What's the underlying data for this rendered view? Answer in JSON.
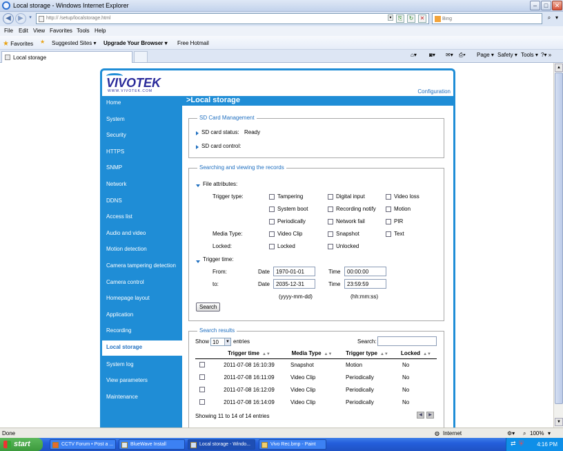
{
  "window": {
    "title": "Local storage - Windows Internet Explorer"
  },
  "address": {
    "url": "http://                    /setup/localstorage.html",
    "search_placeholder": "Bing"
  },
  "menu": [
    "File",
    "Edit",
    "View",
    "Favorites",
    "Tools",
    "Help"
  ],
  "favorites": {
    "label": "Favorites",
    "suggested": "Suggested Sites ▾",
    "upgrade": "Upgrade Your Browser ▾",
    "hotmail": "Free Hotmail"
  },
  "tab": {
    "label": "Local storage"
  },
  "ie_tools": {
    "page": "Page ▾",
    "safety": "Safety ▾",
    "tools": "Tools ▾"
  },
  "brand": {
    "logo": "VIVOTEK",
    "logo_sub": "WWW.VIVOTEK.COM",
    "config": "Configuration",
    "accent_color": "#1f8dd6"
  },
  "sidebar": {
    "items": [
      {
        "label": "Home"
      },
      {
        "label": "System"
      },
      {
        "label": "Security"
      },
      {
        "label": "HTTPS"
      },
      {
        "label": "SNMP"
      },
      {
        "label": "Network"
      },
      {
        "label": "DDNS"
      },
      {
        "label": "Access list"
      },
      {
        "label": "Audio and video"
      },
      {
        "label": "Motion detection"
      },
      {
        "label": "Camera tampering detection"
      },
      {
        "label": "Camera control"
      },
      {
        "label": "Homepage layout"
      },
      {
        "label": "Application"
      },
      {
        "label": "Recording"
      },
      {
        "label": "Local storage"
      },
      {
        "label": "System log"
      },
      {
        "label": "View parameters"
      },
      {
        "label": "Maintenance"
      }
    ],
    "active_index": 15
  },
  "page": {
    "title": ">Local storage"
  },
  "sd": {
    "legend": "SD Card Management",
    "status_label": "SD card status:",
    "status_value": "Ready",
    "control_label": "SD card control:"
  },
  "search": {
    "legend": "Searching and viewing the records",
    "file_attributes": "File attributes:",
    "trigger_type_label": "Trigger type:",
    "trigger_types": [
      "Tampering",
      "Digital input",
      "Video loss",
      "System boot",
      "Recording notify",
      "Motion",
      "Periodically",
      "Network fail",
      "PIR"
    ],
    "media_type_label": "Media Type:",
    "media_types": [
      "Video Clip",
      "Snapshot",
      "Text"
    ],
    "locked_label": "Locked:",
    "locked_options": [
      "Locked",
      "Unlocked"
    ],
    "trigger_time": "Trigger time:",
    "from_label": "From:",
    "to_label": "to:",
    "date_label": "Date",
    "time_label": "Time",
    "from_date": "1970-01-01",
    "from_time": "00:00:00",
    "to_date": "2035-12-31",
    "to_time": "23:59:59",
    "date_format": "(yyyy-mm-dd)",
    "time_format": "(hh:mm:ss)",
    "search_button": "Search"
  },
  "results": {
    "legend": "Search results",
    "show_label": "Show",
    "entries_label": "entries",
    "page_size": "10",
    "search_label": "Search:",
    "columns": [
      "Trigger time",
      "Media Type",
      "Trigger type",
      "Locked"
    ],
    "rows": [
      {
        "time": "2011-07-08 16:10:39",
        "media": "Snapshot",
        "trigger": "Motion",
        "locked": "No"
      },
      {
        "time": "2011-07-08 16:11:09",
        "media": "Video Clip",
        "trigger": "Periodically",
        "locked": "No"
      },
      {
        "time": "2011-07-08 16:12:09",
        "media": "Video Clip",
        "trigger": "Periodically",
        "locked": "No"
      },
      {
        "time": "2011-07-08 16:14:09",
        "media": "Video Clip",
        "trigger": "Periodically",
        "locked": "No"
      }
    ],
    "info": "Showing 11 to 14 of 14 entries"
  },
  "status": {
    "left": "Done",
    "zone": "Internet",
    "zoom": "100%"
  },
  "taskbar": {
    "start": "start",
    "buttons": [
      "CCTV Forum • Post a ...",
      "BlueWave Install",
      "Local storage - Windo...",
      "Vivo Rec.bmp - Paint"
    ],
    "clock": "4:16 PM"
  }
}
